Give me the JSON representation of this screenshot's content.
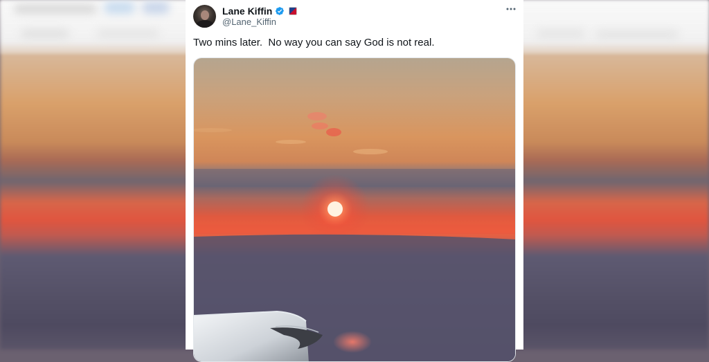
{
  "tweet": {
    "display_name": "Lane Kiffin",
    "handle": "@Lane_Kiffin",
    "text": "Two mins later.  No way you can say God is not real.",
    "verified": true,
    "verified_color": "#1d9bf0",
    "affiliation_icon": "team-logo-icon",
    "more_icon": "more-horizontal-icon",
    "media": {
      "type": "photo",
      "subject": "sunset-from-airplane-window"
    }
  },
  "colors": {
    "text_primary": "#0f1419",
    "text_secondary": "#536471",
    "card_bg": "#ffffff"
  }
}
